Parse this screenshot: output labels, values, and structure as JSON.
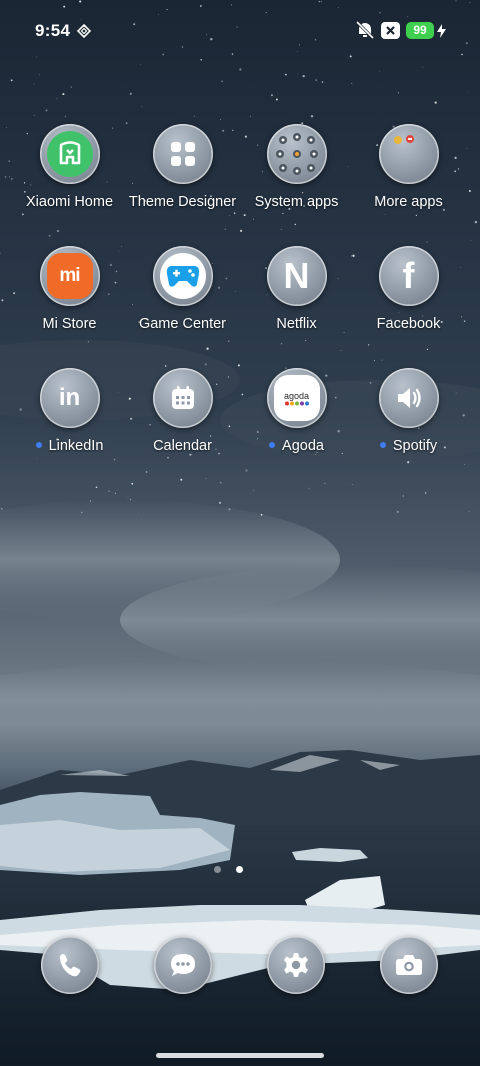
{
  "status_bar": {
    "time": "9:54",
    "battery_level": "99",
    "icons": [
      "nfc-diamond-icon",
      "silent-vibrate-icon",
      "x-box-icon",
      "charging-bolt-icon"
    ]
  },
  "apps": [
    {
      "label": "Xiaomi Home",
      "icon": "xiaomi-home-icon",
      "dot": false
    },
    {
      "label": "Theme Designer",
      "icon": "grid-four-icon",
      "dot": false
    },
    {
      "label": "System apps",
      "icon": "folder-icon",
      "dot": false
    },
    {
      "label": "More apps",
      "icon": "folder-icon",
      "dot": false
    },
    {
      "label": "Mi Store",
      "icon": "mi-store-icon",
      "dot": false
    },
    {
      "label": "Game Center",
      "icon": "gamepad-icon",
      "dot": false
    },
    {
      "label": "Netflix",
      "icon": "netflix-n-icon",
      "dot": false
    },
    {
      "label": "Facebook",
      "icon": "facebook-f-icon",
      "dot": false
    },
    {
      "label": "LinkedIn",
      "icon": "linkedin-icon",
      "dot": true
    },
    {
      "label": "Calendar",
      "icon": "calendar-icon",
      "dot": false
    },
    {
      "label": "Agoda",
      "icon": "agoda-icon",
      "dot": true
    },
    {
      "label": "Spotify",
      "icon": "speaker-icon",
      "dot": true
    }
  ],
  "agoda_logo_text": "agoda",
  "mi_logo_text": "mi",
  "linkedin_logo_text": "in",
  "netflix_logo_text": "N",
  "facebook_logo_text": "f",
  "page_indicator": {
    "pages": 2,
    "active_index": 1
  },
  "dock": [
    {
      "icon": "phone-icon"
    },
    {
      "icon": "messages-icon"
    },
    {
      "icon": "settings-gear-icon"
    },
    {
      "icon": "camera-icon"
    }
  ],
  "colors": {
    "battery_green": "#3ecf4f",
    "notification_dot": "#3f7ef0",
    "xiaomi_home_green": "#3fc26a",
    "mi_orange": "#f06a28"
  }
}
